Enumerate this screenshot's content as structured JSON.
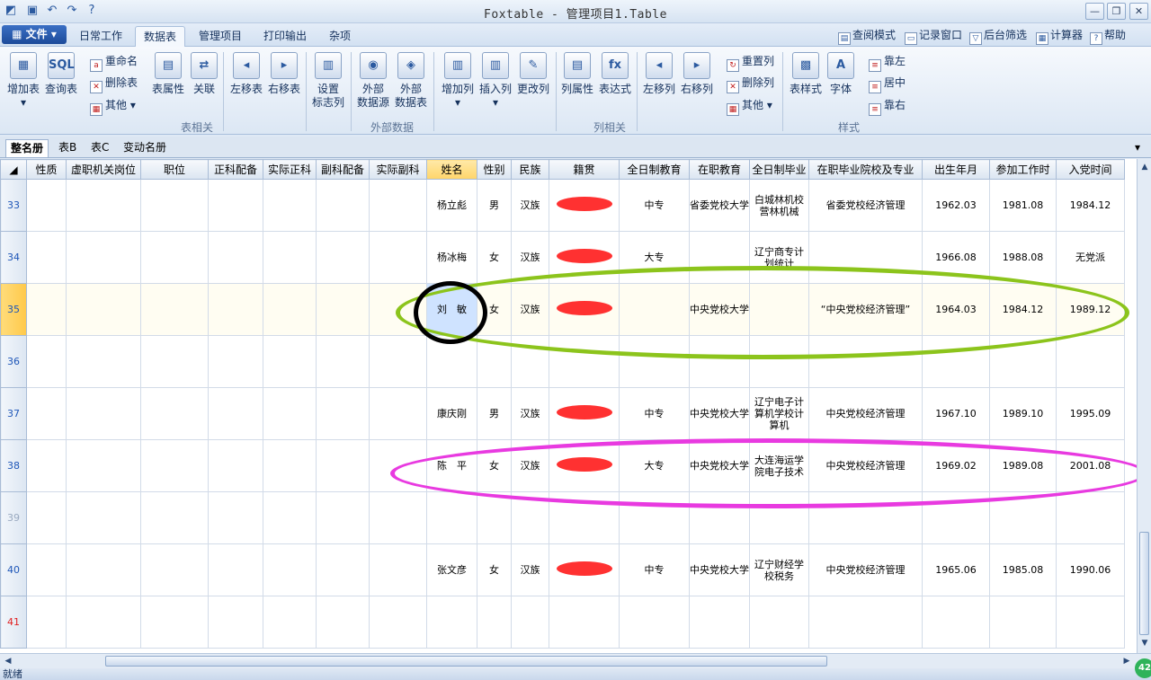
{
  "window": {
    "title": "Foxtable - 管理项目1.Table",
    "min": "—",
    "max": "❐",
    "close": "✕"
  },
  "menu": {
    "file": "▦ 文件 ▾",
    "tabs": [
      "日常工作",
      "数据表",
      "管理项目",
      "打印输出",
      "杂项"
    ],
    "active_tab": "数据表",
    "right_links": [
      "查阅模式",
      "记录窗口",
      "后台筛选",
      "计算器",
      "帮助"
    ]
  },
  "ribbon": {
    "table_group": {
      "add_table": "增加表",
      "query_table": "查询表",
      "rename": "重命名",
      "delete_table": "删除表",
      "other": "其他",
      "table_props": "表属性",
      "relation": "关联",
      "move_left": "左移表",
      "move_right": "右移表",
      "group": "表相关"
    },
    "flag": {
      "label_1": "设置",
      "label_2": "标志列"
    },
    "external": {
      "source_1": "外部",
      "source_2": "数据源",
      "table_1": "外部",
      "table_2": "数据表",
      "group": "外部数据"
    },
    "column_group": {
      "add_col": "增加列",
      "insert_col": "插入列",
      "change_col": "更改列",
      "col_props": "列属性",
      "expression": "表达式",
      "col_left": "左移列",
      "col_right": "右移列",
      "reset_col": "重置列",
      "delete_col": "删除列",
      "other": "其他",
      "group": "列相关"
    },
    "style_group": {
      "table_style": "表样式",
      "font": "字体",
      "align_left": "靠左",
      "align_center": "居中",
      "align_right": "靠右",
      "group": "样式"
    }
  },
  "sheet_tabs": [
    "整名册",
    "表B",
    "表C",
    "变动名册"
  ],
  "active_sheet": "整名册",
  "columns": [
    "性质",
    "虚职机关岗位",
    "职位",
    "正科配备",
    "实际正科",
    "副科配备",
    "实际副科",
    "姓名",
    "性别",
    "民族",
    "籍贯",
    "全日制教育",
    "在职教育",
    "全日制毕业",
    "在职毕业院校及专业",
    "出生年月",
    "参加工作时",
    "入党时间"
  ],
  "rows": [
    {
      "no": "33",
      "name": "杨立彪",
      "gender": "男",
      "ethnicity": "汉族",
      "fulltime_edu": "中专",
      "inservice_edu": "省委党校大学",
      "fulltime_grad": "白城林机校营林机械",
      "inservice_grad": "省委党校经济管理",
      "birth": "1962.03",
      "work_start": "1981.08",
      "party_join": "1984.12"
    },
    {
      "no": "34",
      "name": "杨冰梅",
      "gender": "女",
      "ethnicity": "汉族",
      "fulltime_edu": "大专",
      "inservice_edu": "",
      "fulltime_grad": "辽宁商专计划统计",
      "inservice_grad": "",
      "birth": "1966.08",
      "work_start": "1988.08",
      "party_join": "无党派"
    },
    {
      "no": "35",
      "name": "刘　敏",
      "gender": "女",
      "ethnicity": "汉族",
      "fulltime_edu": "",
      "inservice_edu": "中央党校大学",
      "fulltime_grad": "",
      "inservice_grad": "“中央党校经济管理”",
      "birth": "1964.03",
      "work_start": "1984.12",
      "party_join": "1989.12"
    },
    {
      "no": "36",
      "name": "",
      "gender": "",
      "ethnicity": "",
      "fulltime_edu": "",
      "inservice_edu": "",
      "fulltime_grad": "",
      "inservice_grad": "",
      "birth": "",
      "work_start": "",
      "party_join": ""
    },
    {
      "no": "37",
      "name": "康庆刚",
      "gender": "男",
      "ethnicity": "汉族",
      "fulltime_edu": "中专",
      "inservice_edu": "中央党校大学",
      "fulltime_grad": "辽宁电子计算机学校计算机",
      "inservice_grad": "中央党校经济管理",
      "birth": "1967.10",
      "work_start": "1989.10",
      "party_join": "1995.09"
    },
    {
      "no": "38",
      "name": "陈　平",
      "gender": "女",
      "ethnicity": "汉族",
      "fulltime_edu": "大专",
      "inservice_edu": "中央党校大学",
      "fulltime_grad": "大连海运学院电子技术",
      "inservice_grad": "中央党校经济管理",
      "birth": "1969.02",
      "work_start": "1989.08",
      "party_join": "2001.08"
    },
    {
      "no": "39",
      "name": "",
      "gender": "",
      "ethnicity": "",
      "fulltime_edu": "",
      "inservice_edu": "",
      "fulltime_grad": "",
      "inservice_grad": "",
      "birth": "",
      "work_start": "",
      "party_join": ""
    },
    {
      "no": "40",
      "name": "张文彦",
      "gender": "女",
      "ethnicity": "汉族",
      "fulltime_edu": "中专",
      "inservice_edu": "中央党校大学",
      "fulltime_grad": "辽宁财经学校税务",
      "inservice_grad": "中央党校经济管理",
      "birth": "1965.06",
      "work_start": "1985.08",
      "party_join": "1990.06"
    },
    {
      "no": "41",
      "name": "",
      "gender": "",
      "ethnicity": "",
      "fulltime_edu": "",
      "inservice_edu": "",
      "fulltime_grad": "",
      "inservice_grad": "",
      "birth": "",
      "work_start": "",
      "party_join": ""
    }
  ],
  "status": {
    "text": "就绪",
    "badge": "42"
  },
  "colors": {
    "accent": "#1d4b9a",
    "annotation_green": "#8cc41c",
    "annotation_magenta": "#e83ae0",
    "annotation_black": "#000000",
    "redaction": "#ff2626",
    "current_row": "#ffc94a"
  }
}
